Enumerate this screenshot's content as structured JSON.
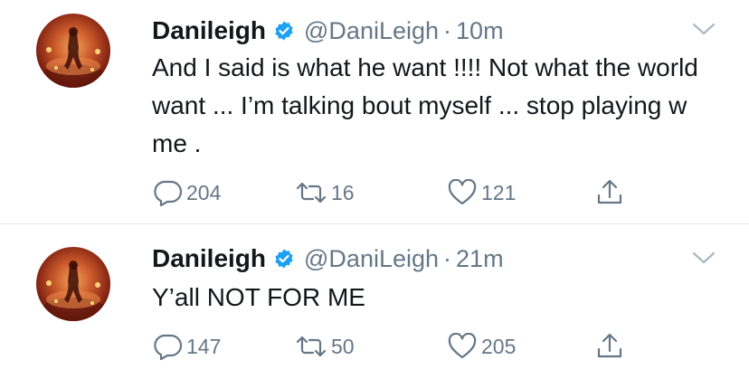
{
  "tweets": [
    {
      "display_name": "Danileigh",
      "handle": "@DaniLeigh",
      "separator": "·",
      "time": "10m",
      "text": "And I said is what he want !!!! Not what the world want ... I’m talking bout myself ... stop playing w me .",
      "replies": "204",
      "retweets": "16",
      "likes": "121"
    },
    {
      "display_name": "Danileigh",
      "handle": "@DaniLeigh",
      "separator": "·",
      "time": "21m",
      "text": "Y’all NOT FOR ME",
      "replies": "147",
      "retweets": "50",
      "likes": "205"
    }
  ],
  "icons": {
    "verified": "verified-badge-icon",
    "more": "chevron-down-icon",
    "reply": "reply-icon",
    "retweet": "retweet-icon",
    "like": "heart-icon",
    "share": "share-icon"
  },
  "colors": {
    "verified_blue": "#1da1f2",
    "secondary_text": "#657786",
    "primary_text": "#14171a",
    "divider": "#e1e8ed"
  }
}
